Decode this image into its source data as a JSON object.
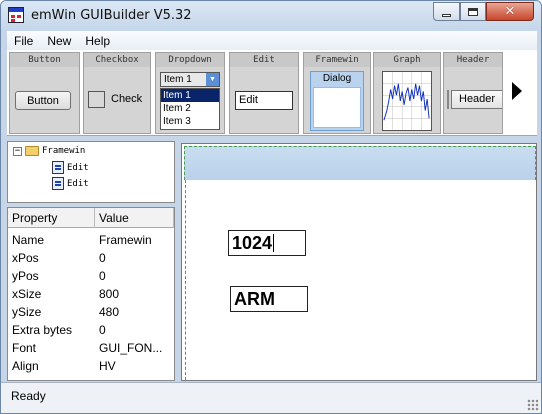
{
  "window": {
    "title": "emWin GUIBuilder V5.32"
  },
  "menu": {
    "items": [
      "File",
      "New",
      "Help"
    ]
  },
  "toolbar": {
    "tools": [
      {
        "head": "Button",
        "label": "Button"
      },
      {
        "head": "Checkbox",
        "label": "Check"
      },
      {
        "head": "Dropdown",
        "selected": "Item 1",
        "options": [
          "Item 1",
          "Item 2",
          "Item 3"
        ]
      },
      {
        "head": "Edit",
        "value": "Edit"
      },
      {
        "head": "Framewin",
        "label": "Dialog"
      },
      {
        "head": "Graph"
      },
      {
        "head": "Header",
        "label": "Header"
      }
    ],
    "scroll_icon": "right-arrow-icon"
  },
  "tree": {
    "root": "Framewin",
    "children": [
      "Edit",
      "Edit"
    ],
    "expander": "−"
  },
  "properties": {
    "headers": [
      "Property",
      "Value"
    ],
    "rows": [
      [
        "Name",
        "Framewin"
      ],
      [
        "xPos",
        "0"
      ],
      [
        "yPos",
        "0"
      ],
      [
        "xSize",
        "800"
      ],
      [
        "ySize",
        "480"
      ],
      [
        "Extra bytes",
        "0"
      ],
      [
        "Font",
        "GUI_FON..."
      ],
      [
        "Align",
        "HV"
      ]
    ]
  },
  "canvas": {
    "edits": [
      {
        "value": "1024"
      },
      {
        "value": "ARM"
      }
    ]
  },
  "status": {
    "text": "Ready"
  },
  "colors": {
    "titlebar": "#c4d6ea",
    "selection": "#0a246a",
    "framewin_title": "#b9d1ea",
    "guide_dash": "#4a9a4a"
  }
}
